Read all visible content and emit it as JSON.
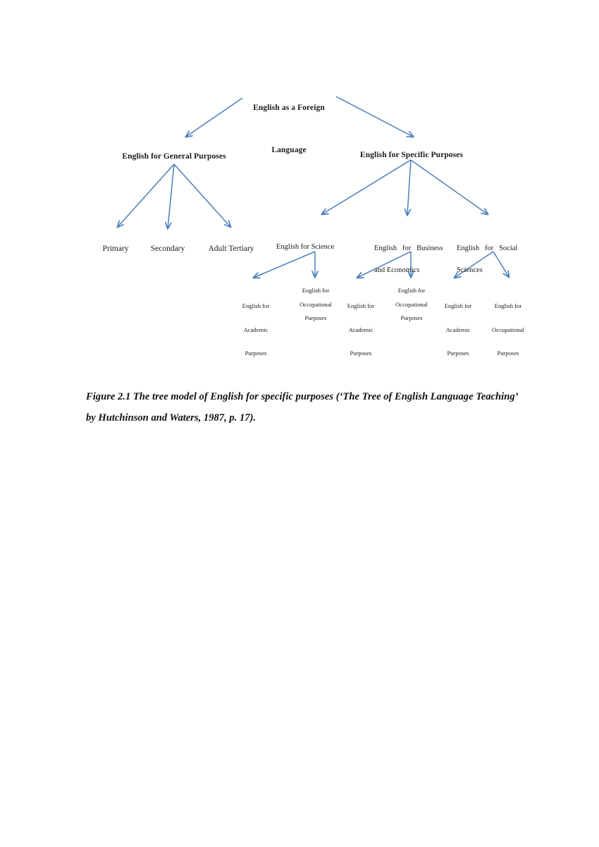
{
  "page": {
    "background_color": "#ffffff",
    "arrow_color": "#4A7EBB",
    "text_color": "#1a1a1a"
  },
  "figure": {
    "caption": "Figure 2.1 The tree model of English for specific purposes (‘The Tree of English Language Teaching’ by Hutchinson and Waters, 1987, p. 17)."
  },
  "diagram": {
    "root": {
      "line1": "English as a Foreign",
      "line2": "Language"
    },
    "branches": {
      "general": {
        "label": "English for General Purposes",
        "children": [
          {
            "label": "Primary"
          },
          {
            "label": "Secondary"
          },
          {
            "label": "Adult Tertiary"
          }
        ]
      },
      "specific": {
        "label": "English for Specific Purposes",
        "children": [
          {
            "label": "English for Science",
            "line1": "English for Science",
            "line2": "",
            "children": [
              {
                "l1": "English for",
                "l2": "Academic",
                "l3": "Purposes",
                "spacing": "wide"
              },
              {
                "l1": "English for",
                "l2": "Occupational",
                "l3": "Purposes",
                "spacing": "tight"
              }
            ]
          },
          {
            "label": "English for Business and Economics",
            "line1": "English   for   Business",
            "line2": "and Economics",
            "children": [
              {
                "l1": "English for",
                "l2": "Academic",
                "l3": "Purposes",
                "spacing": "wide"
              },
              {
                "l1": "English for",
                "l2": "Occupational",
                "l3": "Purposes",
                "spacing": "tight"
              }
            ]
          },
          {
            "label": "English for Social Sciences",
            "line1": "English   for   Social",
            "line2": "Sciences",
            "children": [
              {
                "l1": "English for",
                "l2": "Academic",
                "l3": "Purposes",
                "spacing": "wide"
              },
              {
                "l1": "English for",
                "l2": "Occupational",
                "l3": "Purposes",
                "spacing": "wide"
              }
            ]
          }
        ]
      }
    }
  }
}
